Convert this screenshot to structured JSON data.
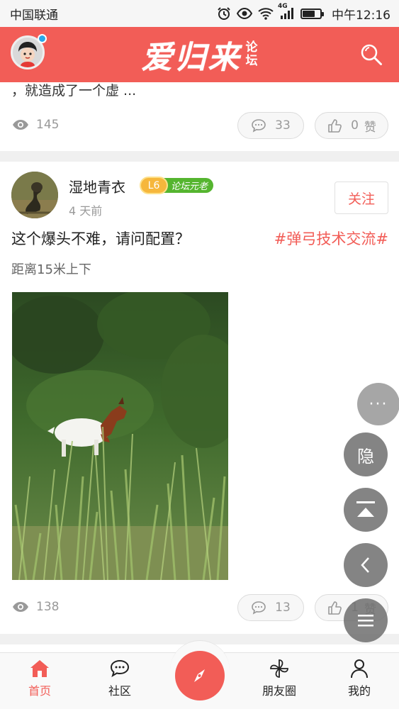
{
  "status_bar": {
    "carrier": "中国联通",
    "network": "4G",
    "time": "中午12:16"
  },
  "header": {
    "logo_main": "爱归来",
    "logo_sub_1": "论",
    "logo_sub_2": "坛",
    "accent_color": "#f25d57"
  },
  "posts": [
    {
      "snippet": "，就造成了一个虚 ...",
      "views": "145",
      "comments": "33",
      "likes": "0",
      "like_unit": "赞"
    },
    {
      "username": "湿地青衣",
      "level": "L6",
      "level_title": "论坛元老",
      "time": "4 天前",
      "follow_label": "关注",
      "title": "这个爆头不难，请问配置？",
      "tag": "#弹弓技术交流#",
      "body": "距离15米上下",
      "image_icon": "goat-in-grass-photo",
      "views": "138",
      "comments": "13",
      "likes": "1",
      "like_unit": "赞"
    }
  ],
  "floating_actions": {
    "more_label": "···",
    "hide_label": "隐"
  },
  "bottom_nav": {
    "items": [
      {
        "label": "首页",
        "icon": "home-icon",
        "active": true
      },
      {
        "label": "社区",
        "icon": "chat-bubbles-icon",
        "active": false
      },
      {
        "label": "",
        "icon": "compass-icon",
        "active": false
      },
      {
        "label": "朋友圈",
        "icon": "pinwheel-icon",
        "active": false
      },
      {
        "label": "我的",
        "icon": "person-icon",
        "active": false
      }
    ]
  }
}
